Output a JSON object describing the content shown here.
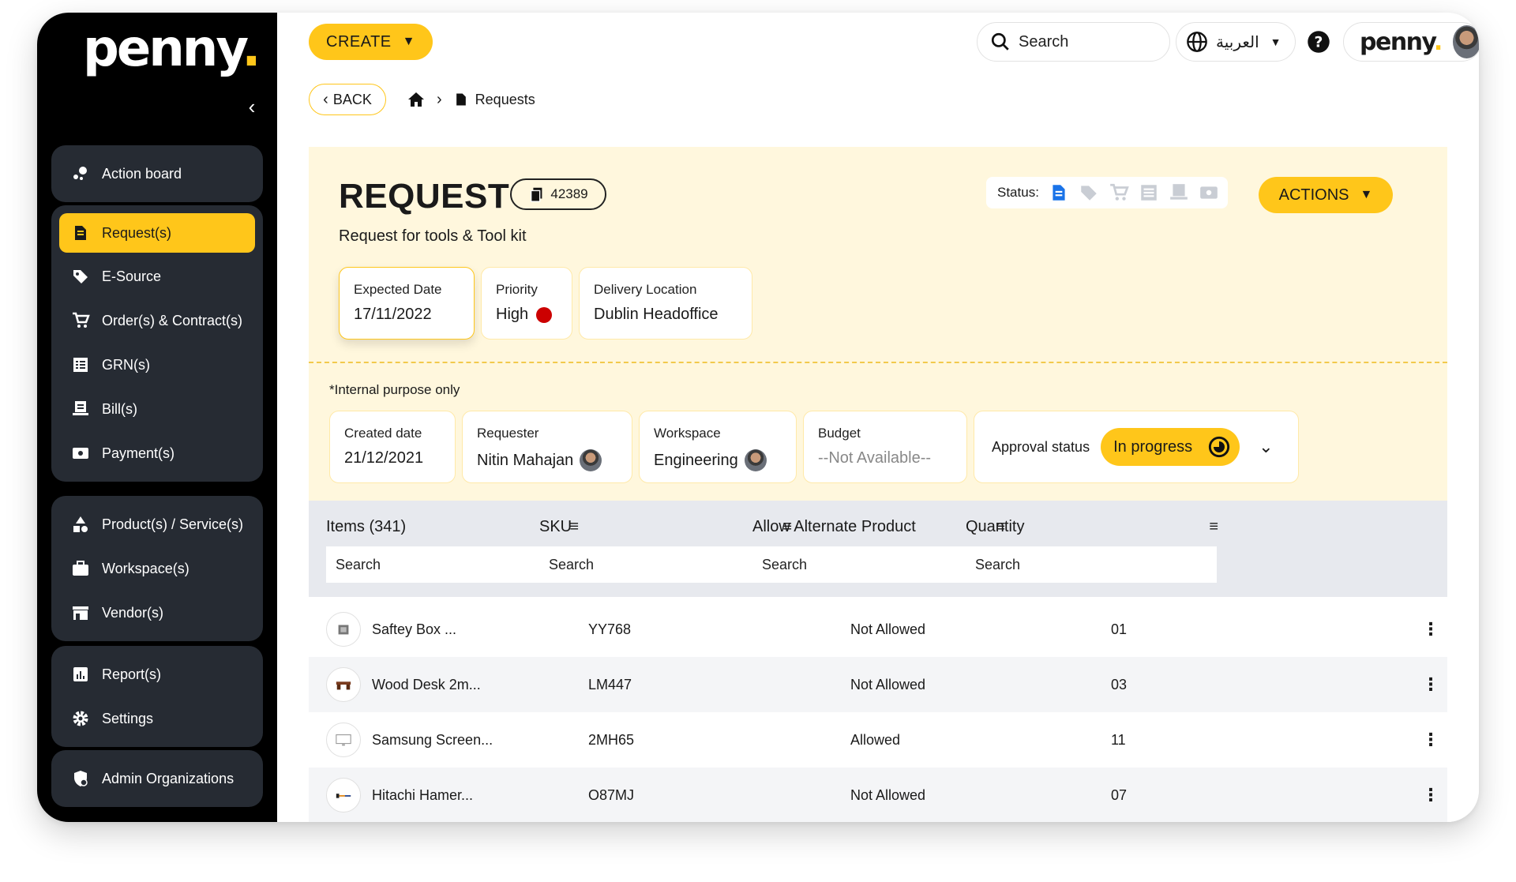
{
  "sidebar": {
    "logo": "penny",
    "logo_dot": ".",
    "groups": [
      [
        {
          "label": "Action board",
          "icon": "action-board-icon"
        }
      ],
      [
        {
          "label": "Request(s)",
          "icon": "request-icon",
          "active": true
        },
        {
          "label": "E-Source",
          "icon": "tag-icon"
        },
        {
          "label": "Order(s) & Contract(s)",
          "icon": "cart-icon"
        },
        {
          "label": "GRN(s)",
          "icon": "list-icon"
        },
        {
          "label": "Bill(s)",
          "icon": "bill-icon"
        },
        {
          "label": "Payment(s)",
          "icon": "payment-icon"
        }
      ],
      [
        {
          "label": "Product(s) / Service(s)",
          "icon": "shapes-icon"
        },
        {
          "label": "Workspace(s)",
          "icon": "briefcase-icon"
        },
        {
          "label": "Vendor(s)",
          "icon": "store-icon"
        }
      ],
      [
        {
          "label": "Report(s)",
          "icon": "report-icon"
        },
        {
          "label": "Settings",
          "icon": "gear-icon"
        }
      ],
      [
        {
          "label": "Admin Organizations",
          "icon": "admin-shield-icon"
        }
      ]
    ]
  },
  "topbar": {
    "create_label": "CREATE",
    "search_placeholder": "Search",
    "language_label": "العربية",
    "profile_logo": "penny",
    "profile_logo_dot": "."
  },
  "nav": {
    "back_label": "BACK",
    "breadcrumb_current": "Requests"
  },
  "request": {
    "title": "REQUEST",
    "id": "42389",
    "subtitle": "Request for tools & Tool kit",
    "status_label": "Status:",
    "actions_label": "ACTIONS",
    "accent_color": "#ffc61a",
    "status_active_color": "#1a73e8"
  },
  "details": {
    "expected_date_label": "Expected Date",
    "expected_date_value": "17/11/2022",
    "priority_label": "Priority",
    "priority_value": "High",
    "priority_color": "#cc0000",
    "delivery_label": "Delivery Location",
    "delivery_value": "Dublin Headoffice"
  },
  "internal": {
    "note": "*Internal purpose only",
    "created_label": "Created date",
    "created_value": "21/12/2021",
    "requester_label": "Requester",
    "requester_value": "Nitin Mahajan",
    "workspace_label": "Workspace",
    "workspace_value": "Engineering",
    "budget_label": "Budget",
    "budget_value": "--Not Available--",
    "approval_label": "Approval status",
    "approval_value": "In progress"
  },
  "table": {
    "columns": [
      "Items (341)",
      "SKU",
      "Allow Alternate Product",
      "Quantity"
    ],
    "search_placeholder": "Search",
    "rows": [
      {
        "item": "Saftey Box ...",
        "sku": "YY768",
        "alternate": "Not Allowed",
        "quantity": "01"
      },
      {
        "item": "Wood Desk 2m...",
        "sku": "LM447",
        "alternate": "Not Allowed",
        "quantity": "03"
      },
      {
        "item": "Samsung Screen...",
        "sku": "2MH65",
        "alternate": "Allowed",
        "quantity": "11"
      },
      {
        "item": "Hitachi Hamer...",
        "sku": "O87MJ",
        "alternate": "Not Allowed",
        "quantity": "07"
      }
    ]
  }
}
